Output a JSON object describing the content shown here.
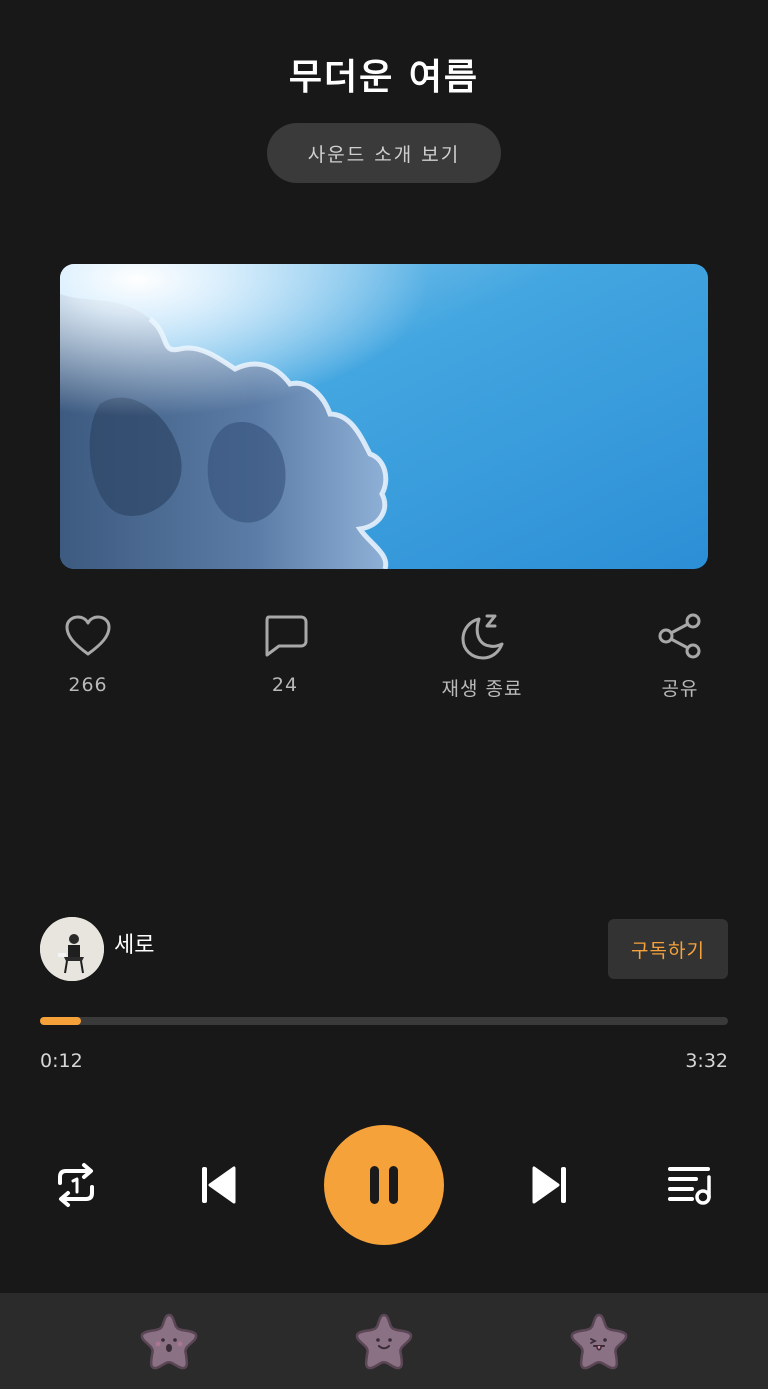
{
  "header": {
    "title": "무더운 여름",
    "intro_button_label": "사운드 소개 보기"
  },
  "cover": {
    "description_icon": "sky-clouds-image"
  },
  "actions": {
    "like": {
      "icon": "heart-icon",
      "label": "266"
    },
    "comment": {
      "icon": "speech-bubble-icon",
      "label": "24"
    },
    "sleep_timer": {
      "icon": "moon-icon",
      "label": "재생 종료"
    },
    "share": {
      "icon": "share-icon",
      "label": "공유"
    }
  },
  "creator": {
    "name": "세로",
    "subscribe_label": "구독하기"
  },
  "player": {
    "current_time": "0:12",
    "total_time": "3:32",
    "progress_fraction": 0.06,
    "state": "playing"
  },
  "controls": {
    "repeat_icon": "repeat-one-icon",
    "previous_icon": "skip-previous-icon",
    "pause_icon": "pause-icon",
    "next_icon": "skip-next-icon",
    "playlist_icon": "playlist-icon"
  },
  "tabs": [
    {
      "icon": "star-surprised-icon"
    },
    {
      "icon": "star-smile-icon"
    },
    {
      "icon": "star-tongue-icon"
    }
  ],
  "colors": {
    "background": "#181818",
    "accent": "#f6a23a",
    "bottom_bar": "#2b2b2b",
    "star_tab": "#8a7184"
  }
}
